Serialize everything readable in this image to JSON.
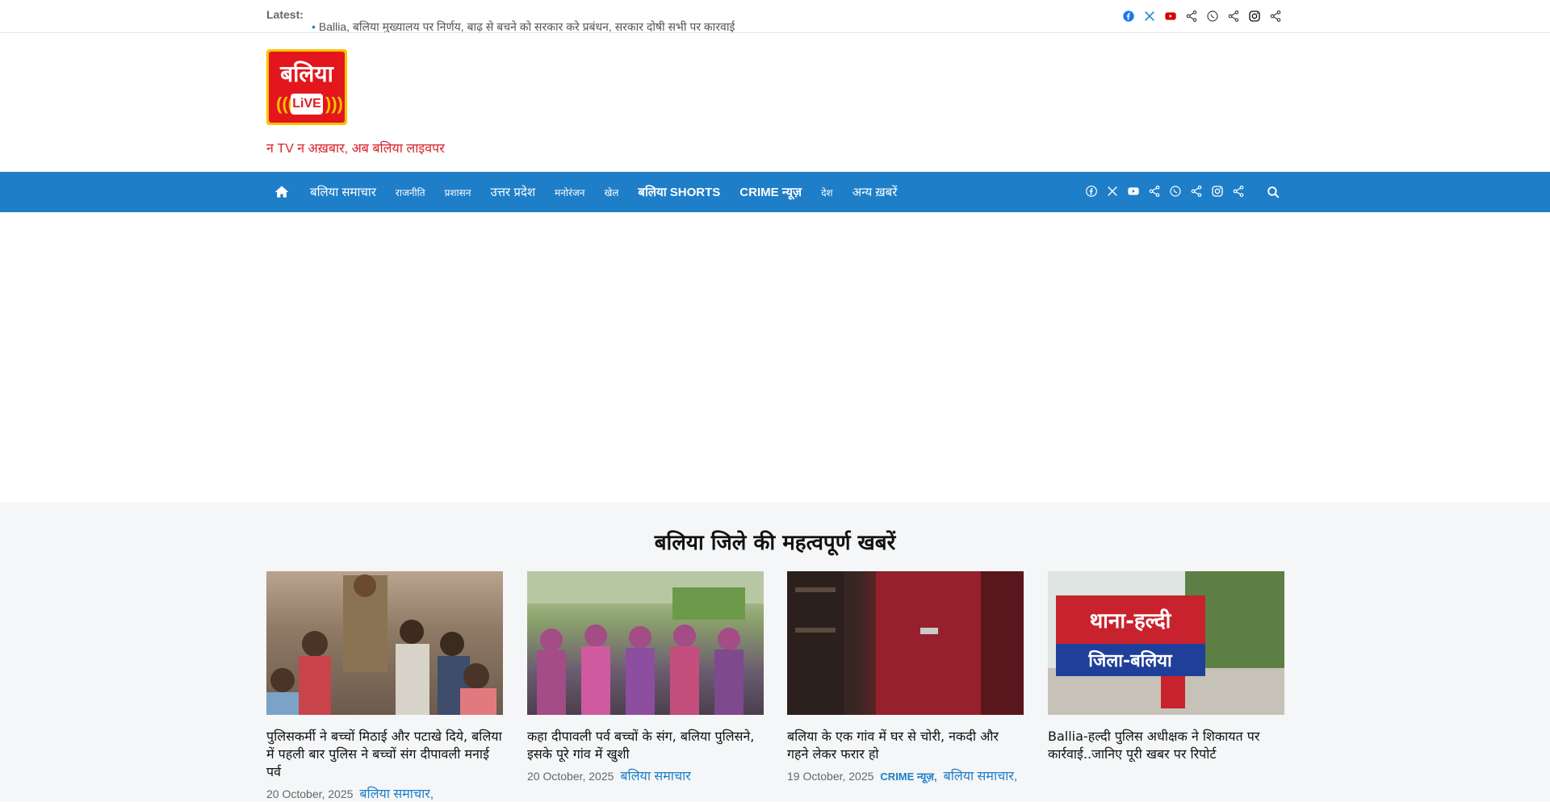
{
  "topbar": {
    "latest_label": "Latest:",
    "ticker_text": "Ballia, बलिया मुख्यालय पर निर्णय, बाढ़ से बचने को सरकार करे प्रबंधन, सरकार दोषी सभी पर कारवाई",
    "socials": [
      "facebook-icon",
      "x-icon",
      "youtube-icon",
      "share-icon",
      "whatsapp-icon",
      "share-icon",
      "instagram-icon",
      "share-icon"
    ]
  },
  "header": {
    "logo_text": "बलिया",
    "logo_live": "LiVE",
    "tagline": "न TV न अख़बार, अब बलिया लाइवपर"
  },
  "nav": {
    "items": [
      {
        "label": "बलिया समाचार",
        "style": ""
      },
      {
        "label": "राजनीति",
        "style": "small"
      },
      {
        "label": "प्रशासन",
        "style": "small"
      },
      {
        "label": "उत्तर प्रदेश",
        "style": ""
      },
      {
        "label": "मनोरंजन",
        "style": "small"
      },
      {
        "label": "खेल",
        "style": "small"
      },
      {
        "label": "बलिया SHORTS",
        "style": "bold"
      },
      {
        "label": "CRIME न्यूज़",
        "style": "bold"
      },
      {
        "label": "देश",
        "style": "small"
      },
      {
        "label": "अन्य ख़बरें",
        "style": ""
      }
    ],
    "socials": [
      "facebook-icon",
      "x-icon",
      "youtube-icon",
      "share-icon",
      "whatsapp-icon",
      "share-icon",
      "instagram-icon",
      "share-icon"
    ]
  },
  "section": {
    "title": "बलिया जिले की महत्वपूर्ण खबरें",
    "cards": [
      {
        "title": "पुलिसकर्मी ने बच्चों मिठाई और पटाखे दिये, बलिया में पहली बार पुलिस ने बच्चों संग दीपावली मनाई पर्व",
        "date": "20 October, 2025",
        "categories": [
          "बलिया समाचार,"
        ]
      },
      {
        "title": "कहा दीपावली पर्व बच्चों के संग, बलिया पुलिसने, इसके पूरे गांव में खुशी",
        "date": "20 October, 2025",
        "categories": [
          "बलिया समाचार"
        ]
      },
      {
        "title": "बलिया के एक गांव में घर से चोरी, नकदी और गहने लेकर फरार हो",
        "date": "19 October, 2025",
        "categories": [
          "CRIME न्यूज़,",
          "बलिया समाचार,"
        ]
      },
      {
        "title": "Ballia-हल्दी पुलिस अधीक्षक ने शिकायत पर कार्रवाई..जानिए पूरी खबर पर रिपोर्ट",
        "date": "",
        "categories": []
      }
    ]
  },
  "colors": {
    "nav_bg": "#1e7ec8",
    "accent_red": "#d9232a",
    "logo_yellow": "#f8c200",
    "logo_red": "#e3161d",
    "section_bg": "#f4f6f8"
  }
}
